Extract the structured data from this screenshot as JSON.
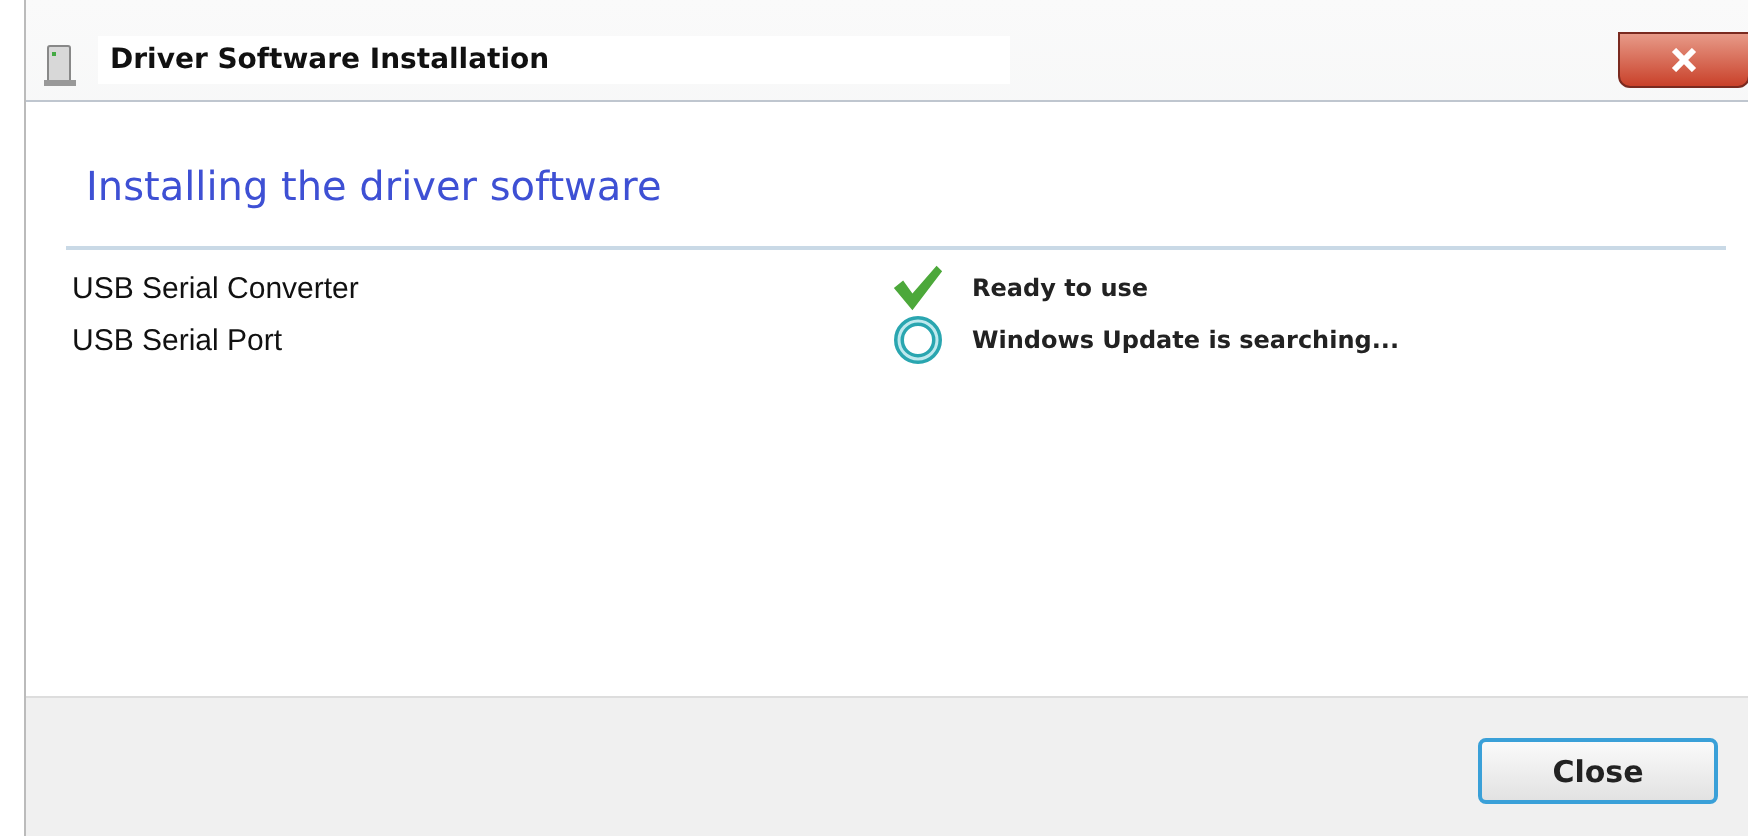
{
  "window": {
    "title": "Driver Software Installation"
  },
  "heading": "Installing the driver software",
  "devices": [
    {
      "name": "USB Serial Converter",
      "kind": "ready",
      "status": "Ready to use"
    },
    {
      "name": "USB Serial Port",
      "kind": "searching",
      "status": "Windows Update is searching..."
    }
  ],
  "buttons": [
    "Close"
  ]
}
